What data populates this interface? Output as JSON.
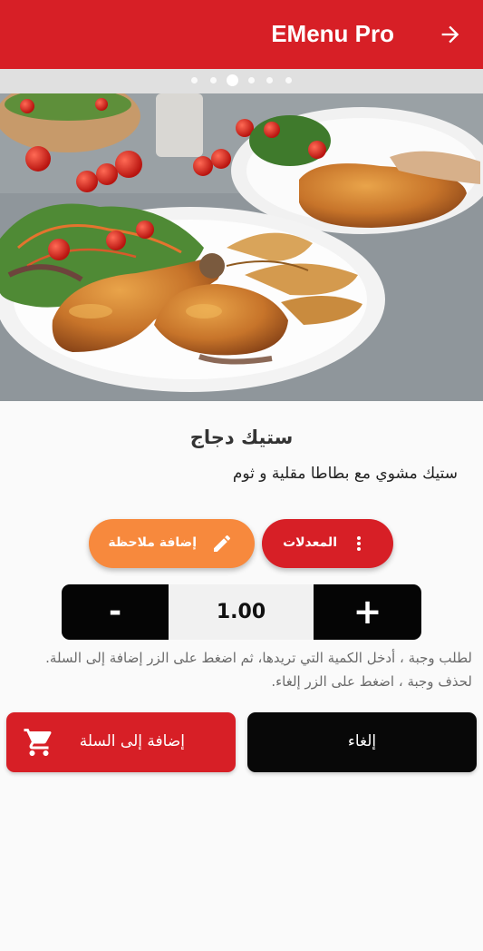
{
  "app": {
    "title": "EMenu Pro",
    "back_icon": "arrow-right-icon"
  },
  "carousel": {
    "pages": 6,
    "active_index": 2
  },
  "dish": {
    "title": "ستيك دجاج",
    "description": "ستيك مشوي مع بطاطا مقلية و ثوم"
  },
  "actions": {
    "modifiers_label": "المعدلات",
    "modifiers_icon": "more-vert-icon",
    "note_label": "إضافة ملاحظة",
    "note_icon": "pencil-icon"
  },
  "quantity": {
    "minus": "-",
    "value": "1.00",
    "plus": "+"
  },
  "help": {
    "line1": "لطلب وجبة ، أدخل الكمية التي تريدها، ثم اضغط على الزر إضافة إلى السلة.",
    "line2": "لحذف وجبة ، اضغط على الزر إلغاء."
  },
  "buttons": {
    "add_to_cart": "إضافة إلى السلة",
    "cart_icon": "cart-icon",
    "cancel": "إلغاء"
  },
  "colors": {
    "primary": "#d71f26",
    "accent": "#f7893d",
    "dark": "#050505"
  }
}
